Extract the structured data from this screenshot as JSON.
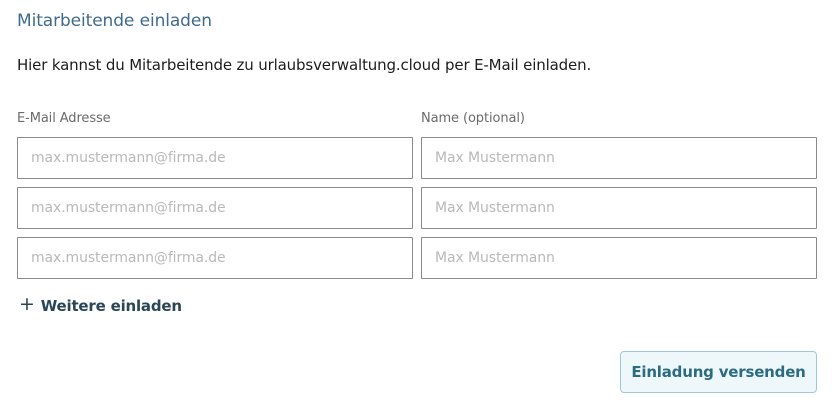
{
  "header": {
    "title": "Mitarbeitende einladen"
  },
  "intro_text": "Hier kannst du Mitarbeitende zu urlaubsverwaltung.cloud per E-Mail einladen.",
  "columns": {
    "email_label": "E-Mail Adresse",
    "name_label": "Name (optional)"
  },
  "rows": [
    {
      "email_value": "",
      "email_placeholder": "max.mustermann@firma.de",
      "name_value": "",
      "name_placeholder": "Max Mustermann"
    },
    {
      "email_value": "",
      "email_placeholder": "max.mustermann@firma.de",
      "name_value": "",
      "name_placeholder": "Max Mustermann"
    },
    {
      "email_value": "",
      "email_placeholder": "max.mustermann@firma.de",
      "name_value": "",
      "name_placeholder": "Max Mustermann"
    }
  ],
  "add_more": {
    "icon": "plus-icon",
    "label": "Weitere einladen"
  },
  "actions": {
    "send_label": "Einladung versenden"
  },
  "colors": {
    "title": "#3f6b8c",
    "button_bg": "#eef8fb",
    "button_border": "#9ec9da",
    "button_text": "#2c6c80",
    "link_text": "#2b4656"
  }
}
